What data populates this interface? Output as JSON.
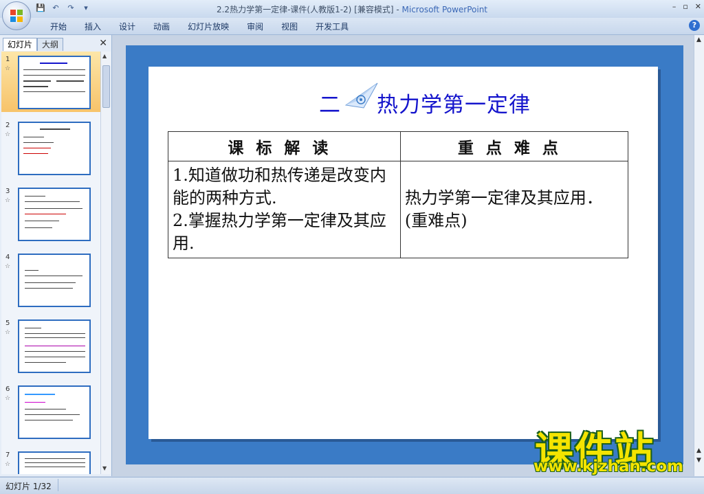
{
  "window": {
    "title_prefix": "2.2热力学第一定律-课件(人教版1-2) [兼容模式] -",
    "title_app": "Microsoft PowerPoint",
    "controls": [
      "–",
      "▫",
      "✕"
    ]
  },
  "quick_access": [
    "💾",
    "↶",
    "↷",
    "▾"
  ],
  "menu": {
    "tabs": [
      "开始",
      "插入",
      "设计",
      "动画",
      "幻灯片放映",
      "审阅",
      "视图",
      "开发工具"
    ],
    "help": "?"
  },
  "left_pane": {
    "tab_slides": "幻灯片",
    "tab_outline": "大纲",
    "close": "✕",
    "thumbnails": [
      {
        "number": "1",
        "star": "☆"
      },
      {
        "number": "2",
        "star": "☆"
      },
      {
        "number": "3",
        "star": "☆"
      },
      {
        "number": "4",
        "star": "☆"
      },
      {
        "number": "5",
        "star": "☆"
      },
      {
        "number": "6",
        "star": "☆"
      },
      {
        "number": "7",
        "star": "☆"
      }
    ]
  },
  "slide": {
    "title_number": "二",
    "title_text": "热力学第一定律",
    "table": {
      "headers": [
        "课标解读",
        "重点难点"
      ],
      "left_lines": [
        "1.知道做功和热传递是改变内能的两种方式.",
        "2.掌握热力学第一定律及其应用."
      ],
      "right_text": "热力学第一定律及其应用．(重难点)"
    }
  },
  "watermark": {
    "logo": "课件站",
    "url": "www.kjzhan.com"
  },
  "status": {
    "slide_counter": "幻灯片 1/32"
  },
  "colors": {
    "slide_frame": "#3a7bc6",
    "title_blue": "#1414cc",
    "watermark_yellow": "#f4e400"
  }
}
